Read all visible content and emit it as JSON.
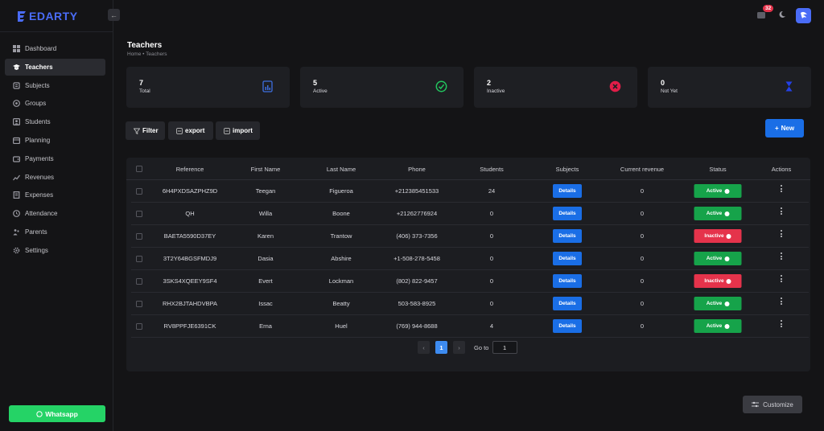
{
  "app": {
    "name": "EDARTY"
  },
  "sidebar": {
    "collapse_icon": "arrow-left-icon",
    "items": [
      {
        "label": "Dashboard",
        "icon": "dashboard-icon",
        "active": false
      },
      {
        "label": "Teachers",
        "icon": "teacher-icon",
        "active": true
      },
      {
        "label": "Subjects",
        "icon": "subjects-icon",
        "active": false
      },
      {
        "label": "Groups",
        "icon": "groups-icon",
        "active": false
      },
      {
        "label": "Students",
        "icon": "students-icon",
        "active": false
      },
      {
        "label": "Planning",
        "icon": "calendar-icon",
        "active": false
      },
      {
        "label": "Payments",
        "icon": "wallet-icon",
        "active": false
      },
      {
        "label": "Revenues",
        "icon": "chart-icon",
        "active": false
      },
      {
        "label": "Expenses",
        "icon": "receipt-icon",
        "active": false
      },
      {
        "label": "Attendance",
        "icon": "clock-icon",
        "active": false
      },
      {
        "label": "Parents",
        "icon": "parents-icon",
        "active": false
      },
      {
        "label": "Settings",
        "icon": "gear-icon",
        "active": false
      }
    ],
    "whatsapp_label": "Whatsapp"
  },
  "topbar": {
    "notification_count": "32"
  },
  "header": {
    "title": "Teachers",
    "breadcrumb": "Home • Teachers"
  },
  "stats": [
    {
      "value": "7",
      "label": "Total",
      "icon": "report-icon",
      "color": "#3d6fe0"
    },
    {
      "value": "5",
      "label": "Active",
      "icon": "check-circle-icon",
      "color": "#22c55e"
    },
    {
      "value": "2",
      "label": "Inactive",
      "icon": "x-circle-icon",
      "color": "#e11d48"
    },
    {
      "value": "0",
      "label": "Not Yet",
      "icon": "hourglass-icon",
      "color": "#2340e6"
    }
  ],
  "actions": {
    "filter": "Filter",
    "export": "export",
    "import": "import",
    "new": "New"
  },
  "table": {
    "columns": [
      "Reference",
      "First Name",
      "Last Name",
      "Phone",
      "Students",
      "Subjects",
      "Current revenue",
      "Status",
      "Actions"
    ],
    "details_label": "Details",
    "rows": [
      {
        "reference": "6H4PXDSAZPHZ9D",
        "first_name": "Teegan",
        "last_name": "Figueroa",
        "phone": "+212385451533",
        "students": "24",
        "revenue": "0",
        "status": "Active"
      },
      {
        "reference": "QH",
        "first_name": "Willa",
        "last_name": "Boone",
        "phone": "+21262776924",
        "students": "0",
        "revenue": "0",
        "status": "Active"
      },
      {
        "reference": "BAETA5590D37EY",
        "first_name": "Karen",
        "last_name": "Trantow",
        "phone": "(406) 373-7356",
        "students": "0",
        "revenue": "0",
        "status": "Inactive"
      },
      {
        "reference": "3T2Y64BGSFMDJ9",
        "first_name": "Dasia",
        "last_name": "Abshire",
        "phone": "+1-508-278-5458",
        "students": "0",
        "revenue": "0",
        "status": "Active"
      },
      {
        "reference": "3SKS4XQEEY9SF4",
        "first_name": "Evert",
        "last_name": "Lockman",
        "phone": "(802) 822-9457",
        "students": "0",
        "revenue": "0",
        "status": "Inactive"
      },
      {
        "reference": "RHX2BJTAHDVBPA",
        "first_name": "Issac",
        "last_name": "Beatty",
        "phone": "503-583-8925",
        "students": "0",
        "revenue": "0",
        "status": "Active"
      },
      {
        "reference": "RV8PPFJE6391CK",
        "first_name": "Erna",
        "last_name": "Huel",
        "phone": "(769) 944-8688",
        "students": "4",
        "revenue": "0",
        "status": "Active"
      }
    ]
  },
  "pagination": {
    "current_page": "1",
    "goto_label": "Go to",
    "goto_value": "1"
  },
  "customize_label": "Customize",
  "colors": {
    "accent": "#1a6ee6",
    "active": "#16a34a",
    "inactive": "#e5334b",
    "whatsapp": "#25d366"
  }
}
